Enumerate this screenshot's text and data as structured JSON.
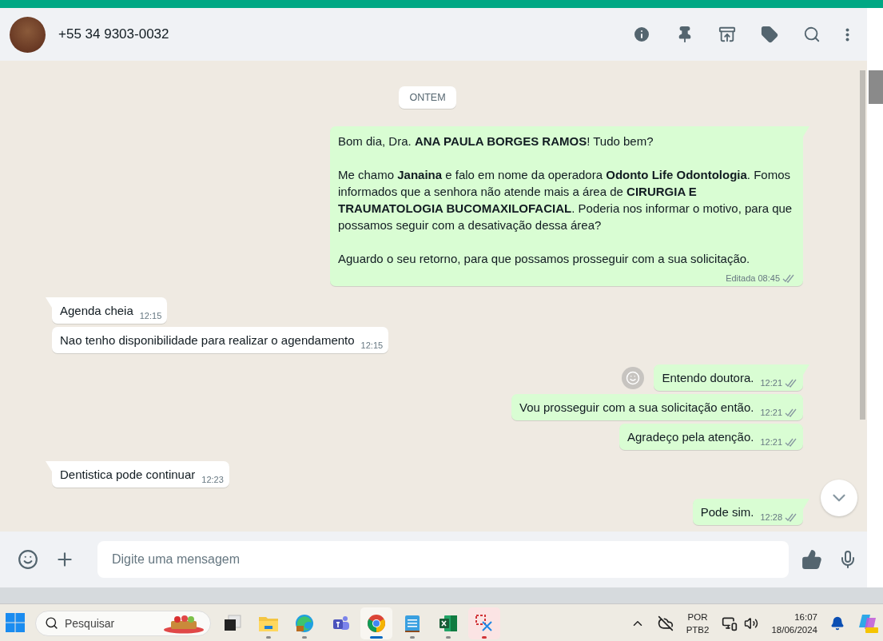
{
  "chat": {
    "contact": {
      "phone": "+55 34 9303-0032"
    },
    "messages": [
      {
        "kind": "date",
        "text": "ONTEM"
      },
      {
        "kind": "outgoing",
        "new_group": true,
        "paragraphs": [
          "Bom dia, Dra. **ANA PAULA BORGES RAMOS**! Tudo bem?",
          "Me chamo **Janaina** e falo em nome da operadora **Odonto Life Odontologia**. Fomos informados que a senhora não atende mais a área de **CIRURGIA E TRAUMATOLOGIA BUCOMAXILOFACIAL**. Poderia nos informar o motivo, para que possamos seguir com a desativação dessa área?",
          "Aguardo o seu retorno, para que possamos prosseguir com a sua solicitação."
        ],
        "edited_label": "Editada",
        "time": "08:45"
      },
      {
        "kind": "incoming",
        "new_group": true,
        "paragraphs": [
          "Agenda cheia"
        ],
        "time": "12:15"
      },
      {
        "kind": "incoming",
        "new_group": false,
        "paragraphs": [
          "Nao tenho disponibilidade para realizar o agendamento"
        ],
        "time": "12:15"
      },
      {
        "kind": "outgoing",
        "new_group": true,
        "reaction_button": true,
        "paragraphs": [
          "Entendo doutora."
        ],
        "time": "12:21"
      },
      {
        "kind": "outgoing",
        "new_group": false,
        "paragraphs": [
          "Vou prosseguir com a sua solicitação então."
        ],
        "time": "12:21"
      },
      {
        "kind": "outgoing",
        "new_group": false,
        "paragraphs": [
          "Agradeço pela atenção."
        ],
        "time": "12:21"
      },
      {
        "kind": "incoming",
        "new_group": true,
        "paragraphs": [
          "Dentistica pode continuar"
        ],
        "time": "12:23"
      },
      {
        "kind": "outgoing",
        "new_group": true,
        "paragraphs": [
          "Pode sim."
        ],
        "time": "12:28"
      }
    ]
  },
  "composer": {
    "placeholder": "Digite uma mensagem"
  },
  "taskbar": {
    "search": {
      "placeholder": "Pesquisar"
    },
    "apps": [
      {
        "kind": "task-view",
        "running": false,
        "selected": false,
        "alert": false
      },
      {
        "kind": "folder",
        "running": true,
        "selected": false,
        "alert": false
      },
      {
        "kind": "edge",
        "running": true,
        "selected": false,
        "alert": false
      },
      {
        "kind": "teams",
        "running": false,
        "selected": false,
        "alert": false
      },
      {
        "kind": "chrome",
        "running": true,
        "selected": true,
        "alert": false
      },
      {
        "kind": "notepad",
        "running": true,
        "selected": false,
        "alert": false
      },
      {
        "kind": "excel",
        "running": true,
        "selected": false,
        "alert": false
      },
      {
        "kind": "snip",
        "running": true,
        "selected": false,
        "alert": true
      }
    ],
    "tray": {
      "language": "POR",
      "layout": "PTB2",
      "time": "16:07",
      "date": "18/06/2024"
    }
  }
}
